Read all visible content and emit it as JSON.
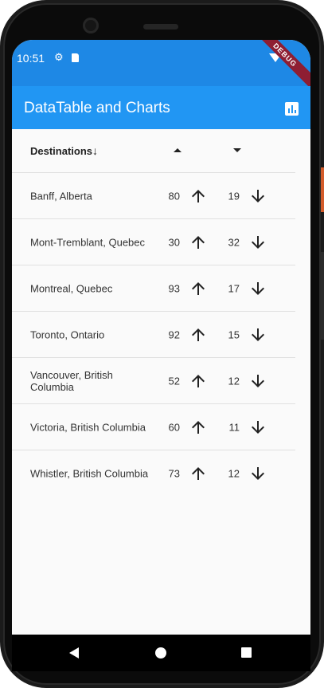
{
  "status_bar": {
    "time": "10:51",
    "debug_label": "DEBUG",
    "icons": [
      "gear-icon",
      "sd-card-icon",
      "wifi-icon"
    ]
  },
  "app_bar": {
    "title": "DataTable and Charts",
    "action_icon": "bar-chart-icon",
    "color": "#2196f3"
  },
  "table": {
    "header": {
      "destinations": "Destinations",
      "sort_arrow": "↓",
      "up_icon": "arrow-drop-up-icon",
      "down_icon": "arrow-drop-down-icon"
    },
    "rows": [
      {
        "name": "Banff, Alberta",
        "up": "80",
        "down": "19"
      },
      {
        "name": "Mont-Tremblant, Quebec",
        "up": "30",
        "down": "32"
      },
      {
        "name": "Montreal, Quebec",
        "up": "93",
        "down": "17"
      },
      {
        "name": "Toronto, Ontario",
        "up": "92",
        "down": "15"
      },
      {
        "name": "Vancouver, British Columbia",
        "up": "52",
        "down": "12"
      },
      {
        "name": "Victoria, British Columbia",
        "up": "60",
        "down": "11"
      },
      {
        "name": "Whistler, British Columbia",
        "up": "73",
        "down": "12"
      }
    ]
  },
  "nav_bar": {
    "icons": [
      "back-icon",
      "home-icon",
      "recent-apps-icon"
    ]
  }
}
